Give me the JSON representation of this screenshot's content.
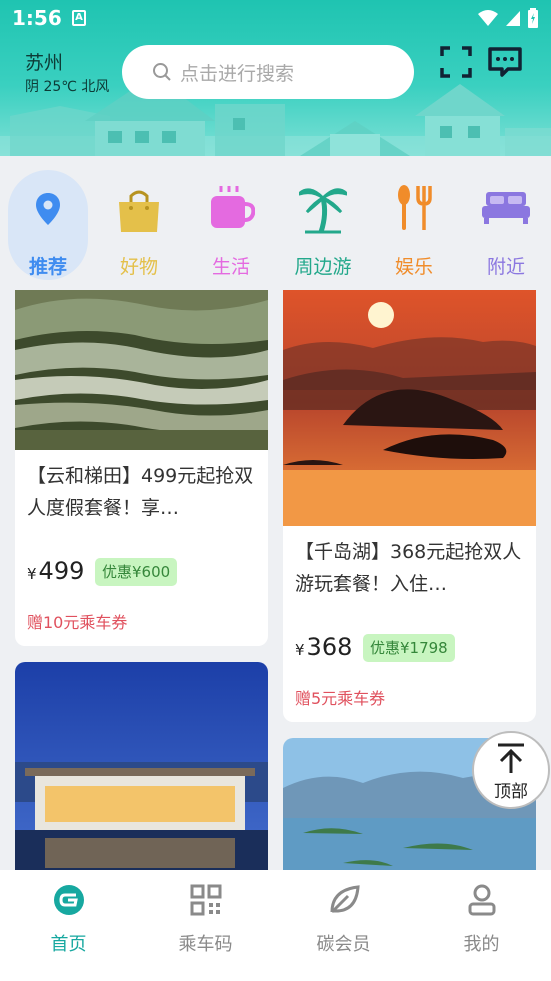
{
  "status_bar": {
    "time": "1:56",
    "notif_letter": "A"
  },
  "header": {
    "city": "苏州",
    "weather": "阴 25℃ 北风",
    "search_placeholder": "点击进行搜索",
    "accent_color": "#1fc4b1"
  },
  "categories": [
    {
      "label": "推荐",
      "icon": "location-pin-icon",
      "color": "#3f8cf0",
      "active": true
    },
    {
      "label": "好物",
      "icon": "shopping-bag-icon",
      "color": "#e4c04a"
    },
    {
      "label": "生活",
      "icon": "coffee-cup-icon",
      "color": "#e46ae0"
    },
    {
      "label": "周边游",
      "icon": "palm-tree-icon",
      "color": "#23a88b"
    },
    {
      "label": "娱乐",
      "icon": "fork-spoon-icon",
      "color": "#f08c2a"
    },
    {
      "label": "附近",
      "icon": "bed-icon",
      "color": "#8b77e0"
    }
  ],
  "feed": [
    {
      "title": "【云和梯田】499元起抢双人度假套餐！享…",
      "price_symbol": "¥",
      "price": "499",
      "promo": "优惠¥600",
      "gift": "赠10元乘车券"
    },
    {
      "title": "【千岛湖】368元起抢双人游玩套餐！入住…",
      "price_symbol": "¥",
      "price": "368",
      "promo": "优惠¥1798",
      "gift": "赠5元乘车券"
    }
  ],
  "top_button": {
    "label": "顶部"
  },
  "bottom_nav": [
    {
      "label": "首页",
      "icon": "home-logo-icon",
      "active": true
    },
    {
      "label": "乘车码",
      "icon": "qr-code-icon"
    },
    {
      "label": "碳会员",
      "icon": "leaf-icon"
    },
    {
      "label": "我的",
      "icon": "user-icon"
    }
  ]
}
